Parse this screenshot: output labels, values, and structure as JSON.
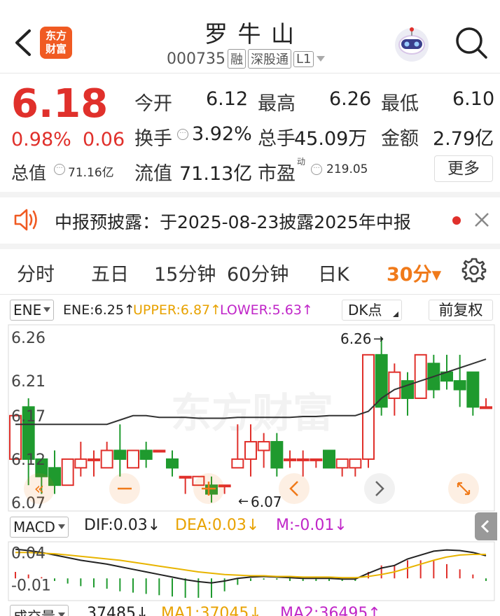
{
  "header": {
    "stock_name": "罗 牛 山",
    "stock_code": "000735",
    "tags": [
      "融",
      "深股通",
      "L1"
    ],
    "logo_text": [
      "东方",
      "财富"
    ]
  },
  "quote": {
    "price": "6.18",
    "change_pct": "0.98%",
    "change": "0.06",
    "rows": [
      [
        {
          "label": "今开",
          "value": "6.12",
          "color": "normal"
        },
        {
          "label": "最高",
          "value": "6.26",
          "color": "red"
        },
        {
          "label": "最低",
          "value": "6.10",
          "color": "green"
        }
      ],
      [
        {
          "label": "换手",
          "value": "3.92%",
          "color": "normal"
        },
        {
          "label": "总手",
          "value": "45.09万",
          "color": "normal"
        },
        {
          "label": "金额",
          "value": "2.79亿",
          "color": "normal"
        }
      ]
    ],
    "total_value_label": "总值",
    "total_value": "71.16亿",
    "float_value_label": "流值",
    "float_value": "71.13亿",
    "pe_label": "市盈",
    "pe_sup": "动",
    "pe_value": "219.05",
    "more_button": "更多"
  },
  "notice": {
    "text": "中报预披露：于2025-08-23披露2025年中报"
  },
  "tabs": {
    "items": [
      "分时",
      "五日",
      "15分钟",
      "60分钟",
      "日K"
    ],
    "active": "30分▾"
  },
  "main_chart": {
    "indicator_select": "ENE",
    "ene": "ENE:6.25↑",
    "upper": "UPPER:6.87↑",
    "lower": "LOWER:5.63↑",
    "dk_button": "DK点",
    "adjust_button": "前复权",
    "y_ticks": [
      "6.26",
      "6.21",
      "6.17",
      "6.12",
      "6.07"
    ],
    "high_marker": "6.26",
    "low_marker": "6.07",
    "watermark": "东方财富"
  },
  "macd": {
    "select": "MACD",
    "dif": "DIF:0.03↓",
    "dea": "DEA:0.03↓",
    "m": "M:-0.01↓",
    "y_ticks": [
      "0.04",
      "-0.01"
    ]
  },
  "volume": {
    "select": "成交量",
    "value": "37485↓",
    "ma1": "MA1:37045↓",
    "ma2": "MA2:36495↑"
  },
  "colors": {
    "up": "#e0302b",
    "down": "#1f9a2e",
    "accent": "#f07a1a",
    "upper": "#e8a200",
    "lower": "#c026c8"
  },
  "chart_data": {
    "type": "candlestick",
    "ylim": [
      6.07,
      6.26
    ],
    "y_ticks": [
      6.26,
      6.21,
      6.17,
      6.12,
      6.07
    ],
    "candles": [
      [
        6.12,
        6.17,
        6.17,
        6.12
      ],
      [
        6.18,
        6.12,
        6.19,
        6.09
      ],
      [
        6.12,
        6.1,
        6.12,
        6.08
      ],
      [
        6.11,
        6.09,
        6.13,
        6.08
      ],
      [
        6.09,
        6.12,
        6.12,
        6.09
      ],
      [
        6.11,
        6.12,
        6.14,
        6.1
      ],
      [
        6.12,
        6.12,
        6.13,
        6.1
      ],
      [
        6.11,
        6.13,
        6.14,
        6.11
      ],
      [
        6.13,
        6.12,
        6.16,
        6.1
      ],
      [
        6.11,
        6.13,
        6.13,
        6.11
      ],
      [
        6.13,
        6.12,
        6.14,
        6.11
      ],
      [
        6.13,
        6.13,
        6.13,
        6.13
      ],
      [
        6.12,
        6.11,
        6.13,
        6.1
      ],
      [
        6.1,
        6.1,
        6.1,
        6.08
      ],
      [
        6.09,
        6.1,
        6.1,
        6.09
      ],
      [
        6.09,
        6.08,
        6.1,
        6.07
      ],
      [
        6.09,
        6.09,
        6.09,
        6.08
      ],
      [
        6.11,
        6.12,
        6.16,
        6.11
      ],
      [
        6.12,
        6.14,
        6.16,
        6.1
      ],
      [
        6.13,
        6.14,
        6.15,
        6.11
      ],
      [
        6.14,
        6.11,
        6.15,
        6.1
      ],
      [
        6.12,
        6.12,
        6.13,
        6.11
      ],
      [
        6.12,
        6.12,
        6.13,
        6.1
      ],
      [
        6.12,
        6.12,
        6.12,
        6.11
      ],
      [
        6.13,
        6.11,
        6.13,
        6.11
      ],
      [
        6.11,
        6.12,
        6.12,
        6.1
      ],
      [
        6.11,
        6.12,
        6.12,
        6.1
      ],
      [
        6.12,
        6.24,
        6.24,
        6.11
      ],
      [
        6.24,
        6.18,
        6.26,
        6.17
      ],
      [
        6.19,
        6.22,
        6.23,
        6.17
      ],
      [
        6.21,
        6.19,
        6.22,
        6.17
      ],
      [
        6.19,
        6.24,
        6.24,
        6.19
      ],
      [
        6.23,
        6.2,
        6.24,
        6.19
      ],
      [
        6.22,
        6.21,
        6.24,
        6.2
      ],
      [
        6.21,
        6.2,
        6.24,
        6.18
      ],
      [
        6.22,
        6.18,
        6.22,
        6.17
      ],
      [
        6.18,
        6.18,
        6.19,
        6.18
      ]
    ],
    "ene_line": [
      6.16,
      6.16,
      6.16,
      6.16,
      6.16,
      6.16,
      6.16,
      6.16,
      6.165,
      6.17,
      6.17,
      6.168,
      6.168,
      6.168,
      6.167,
      6.167,
      6.167,
      6.168,
      6.168,
      6.168,
      6.168,
      6.168,
      6.169,
      6.169,
      6.17,
      6.17,
      6.17,
      6.175,
      6.19,
      6.2,
      6.205,
      6.21,
      6.215,
      6.22,
      6.225,
      6.23,
      6.235
    ],
    "macd": {
      "dif": [
        0.045,
        0.043,
        0.04,
        0.036,
        0.032,
        0.028,
        0.025,
        0.022,
        0.018,
        0.014,
        0.01,
        0.006,
        0.002,
        -0.002,
        -0.005,
        -0.007,
        -0.004,
        0.0,
        0.002,
        0.003,
        0.002,
        0.001,
        0.0,
        0.0,
        0.0,
        -0.001,
        -0.001,
        0.008,
        0.016,
        0.02,
        0.03,
        0.036,
        0.042,
        0.044,
        0.043,
        0.04,
        0.035
      ],
      "dea": [
        0.04,
        0.04,
        0.039,
        0.038,
        0.036,
        0.034,
        0.032,
        0.03,
        0.028,
        0.025,
        0.022,
        0.019,
        0.016,
        0.013,
        0.01,
        0.008,
        0.006,
        0.005,
        0.004,
        0.004,
        0.003,
        0.003,
        0.002,
        0.002,
        0.002,
        0.001,
        0.001,
        0.003,
        0.006,
        0.01,
        0.016,
        0.022,
        0.028,
        0.033,
        0.036,
        0.037,
        0.037
      ],
      "m": [
        0.01,
        0.006,
        0.002,
        -0.004,
        -0.008,
        -0.012,
        -0.014,
        -0.016,
        -0.02,
        -0.022,
        -0.024,
        -0.026,
        -0.028,
        -0.03,
        -0.03,
        -0.03,
        -0.02,
        -0.01,
        -0.004,
        -0.002,
        -0.002,
        -0.004,
        -0.004,
        -0.004,
        -0.004,
        -0.004,
        -0.004,
        0.01,
        0.02,
        0.02,
        0.028,
        0.028,
        0.028,
        0.022,
        0.014,
        0.006,
        -0.004
      ]
    }
  }
}
